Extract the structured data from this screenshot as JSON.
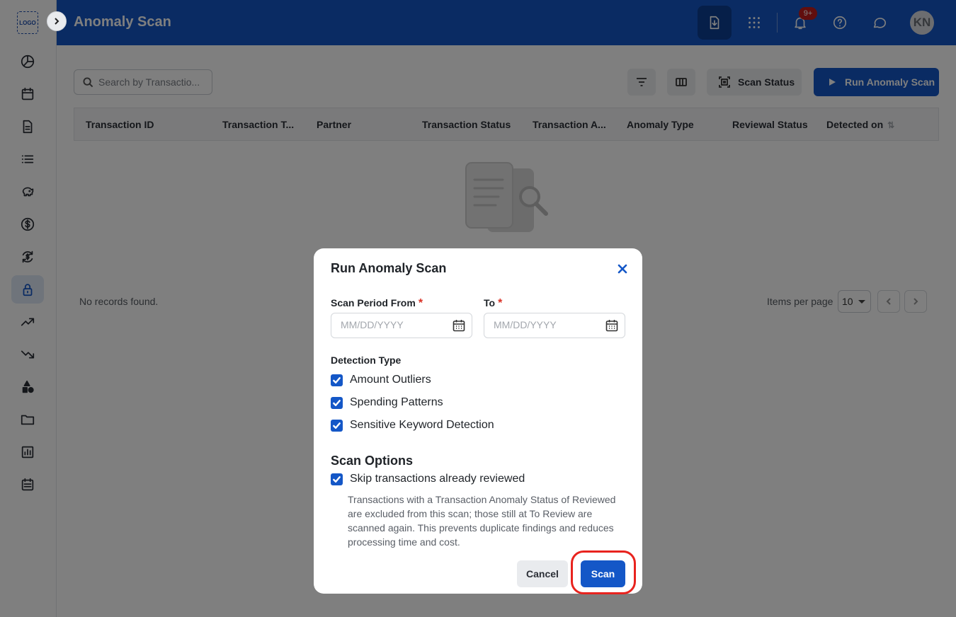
{
  "app": {
    "logo_text": "LOGO",
    "page_title": "Anomaly Scan"
  },
  "header": {
    "notification_badge": "9+",
    "avatar_initials": "KN"
  },
  "sidebar": {
    "items": [
      {
        "icon": "pie-chart-icon"
      },
      {
        "icon": "calendar-icon"
      },
      {
        "icon": "document-icon"
      },
      {
        "icon": "list-icon"
      },
      {
        "icon": "piggy-bank-icon"
      },
      {
        "icon": "dollar-icon"
      },
      {
        "icon": "currency-exchange-icon"
      },
      {
        "icon": "lock-icon",
        "active": true
      },
      {
        "icon": "trending-up-icon"
      },
      {
        "icon": "trending-down-icon"
      },
      {
        "icon": "shapes-icon"
      },
      {
        "icon": "folder-icon"
      },
      {
        "icon": "bar-chart-icon"
      },
      {
        "icon": "calendar-list-icon"
      }
    ]
  },
  "toolbar": {
    "search_placeholder": "Search by Transactio...",
    "scan_status_label": "Scan Status",
    "run_scan_label": "Run Anomaly Scan"
  },
  "table": {
    "columns": [
      "Transaction ID",
      "Transaction T...",
      "Partner",
      "Transaction Status",
      "Transaction A...",
      "Anomaly Type",
      "Reviewal Status",
      "Detected on"
    ],
    "empty_text": "No records found."
  },
  "pagination": {
    "items_per_page_label": "Items per page",
    "items_per_page_value": "10"
  },
  "dialog": {
    "title": "Run Anomaly Scan",
    "from_label": "Scan Period From",
    "to_label": "To",
    "required_marker": "*",
    "date_placeholder": "MM/DD/YYYY",
    "detection_type_label": "Detection Type",
    "detection_types": [
      {
        "label": "Amount Outliers",
        "checked": true
      },
      {
        "label": "Spending Patterns",
        "checked": true
      },
      {
        "label": "Sensitive Keyword Detection",
        "checked": true
      }
    ],
    "scan_options_label": "Scan Options",
    "skip_reviewed_label": "Skip transactions already reviewed",
    "skip_reviewed_checked": true,
    "help_text": "Transactions with a Transaction Anomaly Status of Reviewed are excluded from this scan; those still at To Review are scanned again. This prevents duplicate findings and reduces processing time and cost.",
    "cancel_label": "Cancel",
    "scan_label": "Scan"
  },
  "colors": {
    "primary": "#1457c7",
    "highlight": "#e8231e",
    "badge": "#c21d1d"
  }
}
